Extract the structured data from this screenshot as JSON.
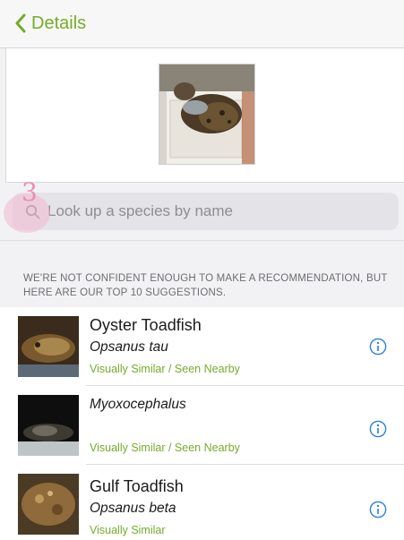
{
  "navbar": {
    "back_label": "Details"
  },
  "annotation": {
    "text": "3",
    "color": "#e88fb4"
  },
  "search": {
    "placeholder": "Look up a species by name"
  },
  "section": {
    "header": "We're not confident enough to make a recommendation, but here are our top 10 suggestions."
  },
  "results": [
    {
      "common_name": "Oyster Toadfish",
      "scientific_name": "Opsanus tau",
      "tag": "Visually Similar / Seen Nearby"
    },
    {
      "common_name": "",
      "scientific_name": "Myoxocephalus",
      "tag": "Visually Similar / Seen Nearby"
    },
    {
      "common_name": "Gulf Toadfish",
      "scientific_name": "Opsanus beta",
      "tag": "Visually Similar"
    }
  ],
  "colors": {
    "accent": "#74ac2b",
    "info_blue": "#2a7fe0",
    "annotation_pink": "#e88fb4"
  },
  "icons": {
    "back": "chevron-left-icon",
    "search": "magnifier-icon",
    "info": "info-circle-icon"
  }
}
